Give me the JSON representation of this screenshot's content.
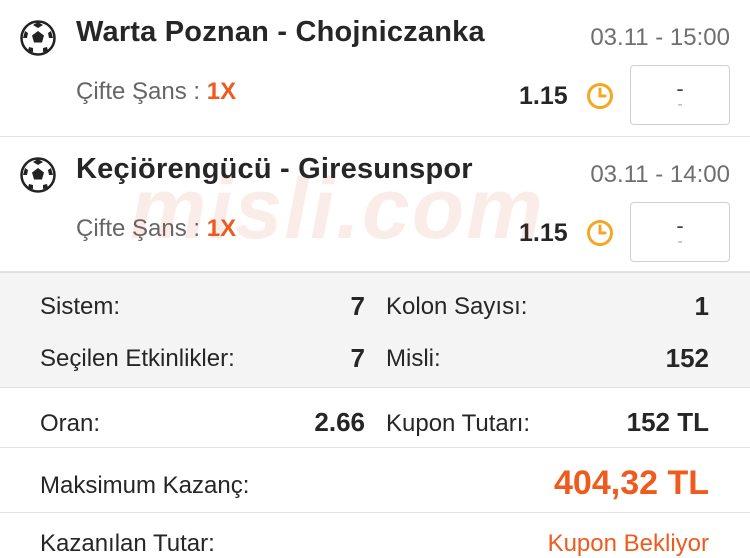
{
  "matches": [
    {
      "teams": "Warta Poznan - Chojniczanka",
      "datetime": "03.11 - 15:00",
      "market_label": "Çifte Şans :",
      "selection": "1X",
      "odd": "1.15",
      "score_top": "-",
      "score_bottom": "-"
    },
    {
      "teams": "Keçiörengücü - Giresunspor",
      "datetime": "03.11 - 14:00",
      "market_label": "Çifte Şans :",
      "selection": "1X",
      "odd": "1.15",
      "score_top": "-",
      "score_bottom": "-"
    }
  ],
  "watermark": "misli.com",
  "summary": {
    "sistem_label": "Sistem:",
    "sistem_value": "7",
    "kolon_label": "Kolon Sayısı:",
    "kolon_value": "1",
    "secilen_label": "Seçilen Etkinlikler:",
    "secilen_value": "7",
    "misli_label": "Misli:",
    "misli_value": "152"
  },
  "details": {
    "oran_label": "Oran:",
    "oran_value": "2.66",
    "kupon_label": "Kupon Tutarı:",
    "kupon_value": "152 TL",
    "max_label": "Maksimum Kazanç:",
    "max_value": "404,32 TL",
    "kazanilan_label": "Kazanılan Tutar:",
    "kazanilan_value": "Kupon Bekliyor"
  },
  "colors": {
    "accent": "#ee5b1f",
    "clock": "#f5a623"
  }
}
